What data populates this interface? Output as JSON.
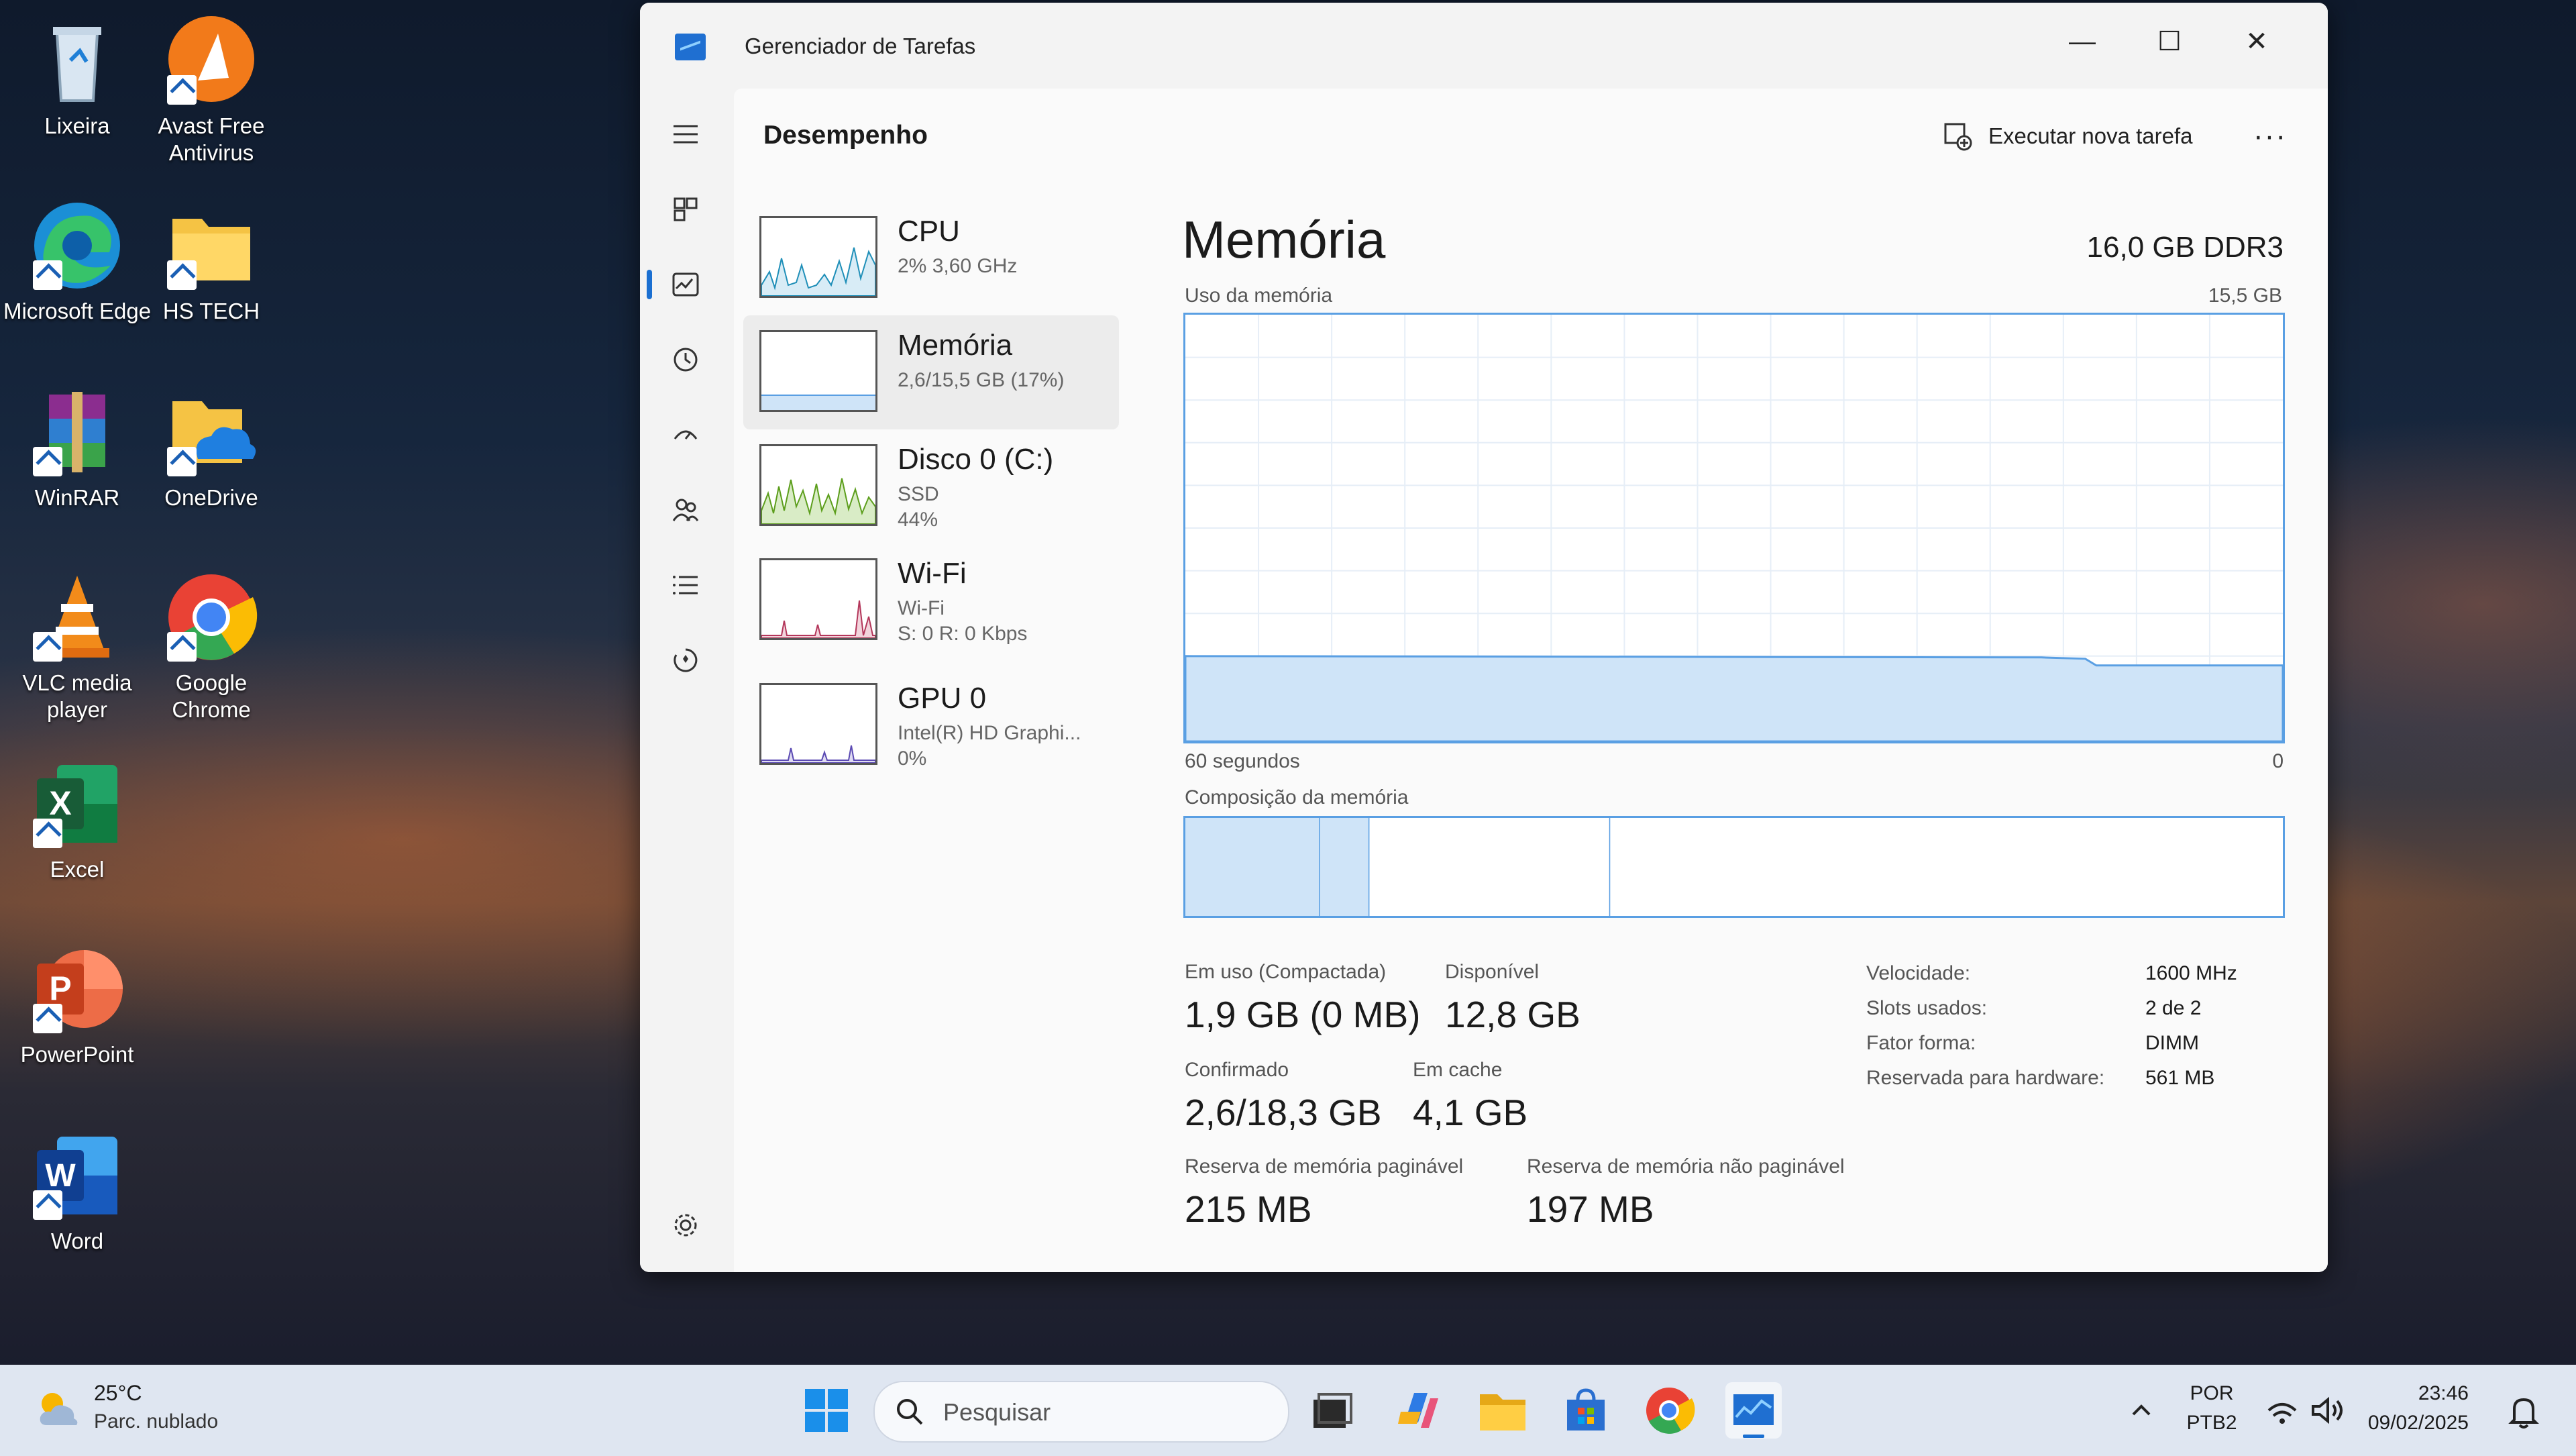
{
  "desktop": {
    "icons": [
      {
        "label": "Lixeira"
      },
      {
        "label": "Avast Free Antivirus"
      },
      {
        "label": "Microsoft Edge"
      },
      {
        "label": "HS TECH"
      },
      {
        "label": "WinRAR"
      },
      {
        "label": "OneDrive"
      },
      {
        "label": "VLC media player"
      },
      {
        "label": "Google Chrome"
      },
      {
        "label": "Excel"
      },
      {
        "label": "PowerPoint"
      },
      {
        "label": "Word"
      }
    ]
  },
  "window": {
    "title": "Gerenciador de Tarefas",
    "controls": {
      "minimize": "—",
      "maximize": "☐",
      "close": "✕"
    }
  },
  "header": {
    "title": "Desempenho",
    "run_task": "Executar nova tarefa",
    "more": "···"
  },
  "resources": [
    {
      "name": "CPU",
      "sub1": "2% 3,60 GHz",
      "sub2": "",
      "sub3": ""
    },
    {
      "name": "Memória",
      "sub1": "2,6/15,5 GB (17%)",
      "sub2": "",
      "sub3": ""
    },
    {
      "name": "Disco 0 (C:)",
      "sub1": "SSD",
      "sub2": "44%",
      "sub3": ""
    },
    {
      "name": "Wi-Fi",
      "sub1": "Wi-Fi",
      "sub2": "S: 0 R: 0 Kbps",
      "sub3": ""
    },
    {
      "name": "GPU 0",
      "sub1": "Intel(R) HD Graphi...",
      "sub2": "0%",
      "sub3": ""
    }
  ],
  "memory": {
    "title": "Memória",
    "spec": "16,0 GB DDR3",
    "usage_label": "Uso da memória",
    "usage_max": "15,5 GB",
    "time_left": "60 segundos",
    "time_right": "0",
    "composition_label": "Composição da memória",
    "usage_fraction": 0.2,
    "composition": {
      "in_use_gb": 1.9,
      "modified_gb": 0.7,
      "standby_gb": 3.4,
      "free_gb": 9.5
    },
    "stats": {
      "in_use_label": "Em uso (Compactada)",
      "in_use_value": "1,9 GB (0 MB)",
      "available_label": "Disponível",
      "available_value": "12,8 GB",
      "committed_label": "Confirmado",
      "committed_value": "2,6/18,3 GB",
      "cached_label": "Em cache",
      "cached_value": "4,1 GB",
      "paged_label": "Reserva de memória paginável",
      "paged_value": "215 MB",
      "nonpaged_label": "Reserva de memória não paginável",
      "nonpaged_value": "197 MB"
    },
    "details": [
      {
        "k": "Velocidade:",
        "v": "1600 MHz"
      },
      {
        "k": "Slots usados:",
        "v": "2 de 2"
      },
      {
        "k": "Fator forma:",
        "v": "DIMM"
      },
      {
        "k": "Reservada para hardware:",
        "v": "561 MB"
      }
    ]
  },
  "taskbar": {
    "weather_temp": "25°C",
    "weather_desc": "Parc. nublado",
    "search_placeholder": "Pesquisar",
    "lang1": "POR",
    "lang2": "PTB2",
    "time": "23:46",
    "date": "09/02/2025"
  },
  "colors": {
    "accent": "#1a6fd1",
    "graph_line": "#5a9fe3",
    "graph_fill": "#cfe4f8"
  }
}
